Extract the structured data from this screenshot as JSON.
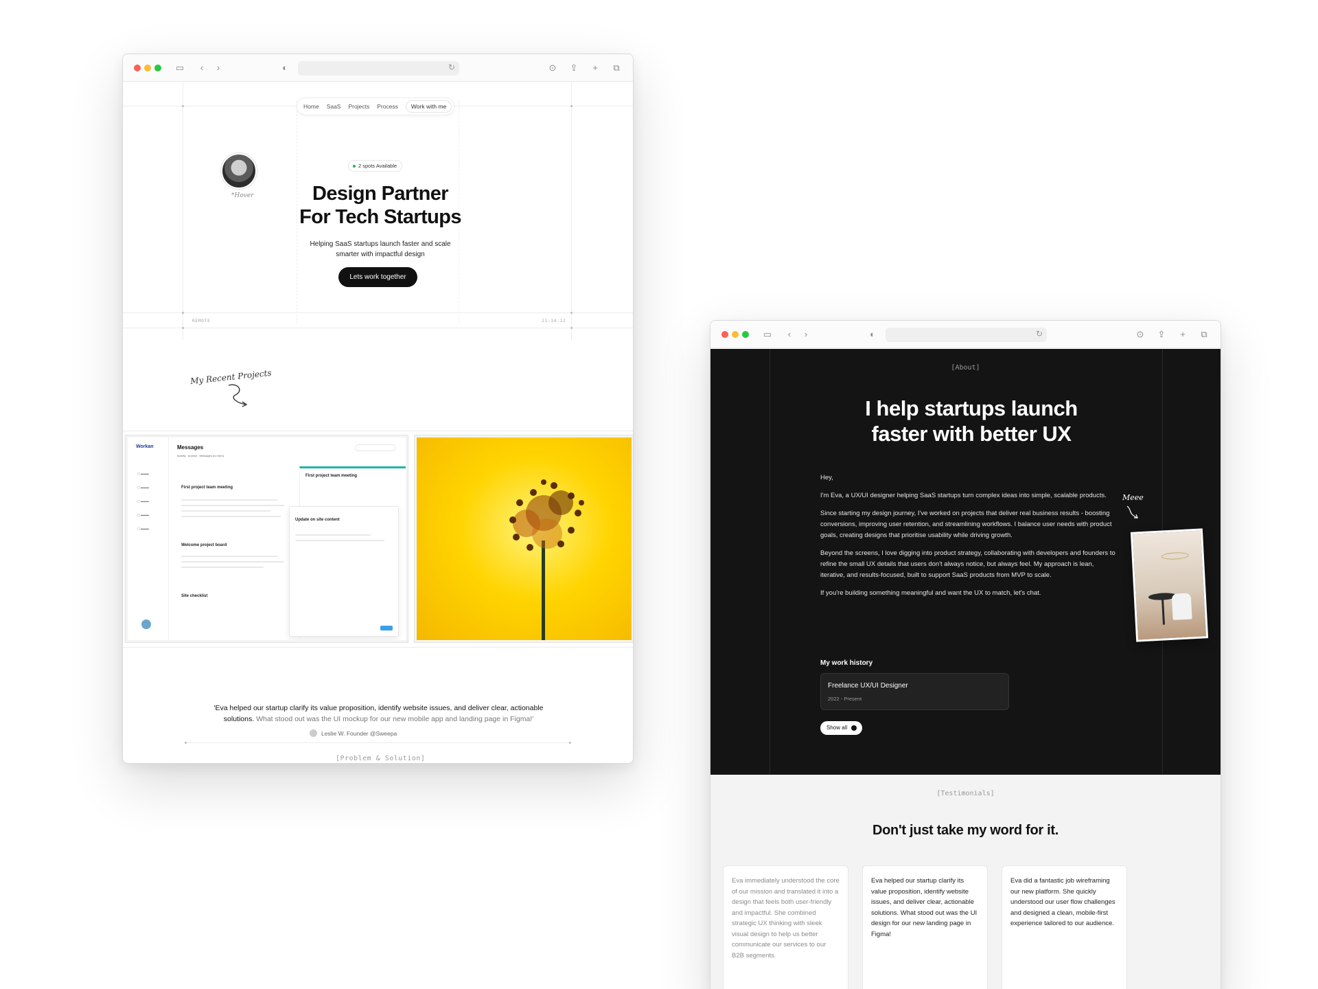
{
  "window1": {
    "nav": {
      "items": [
        "Home",
        "SaaS",
        "Projects",
        "Process"
      ],
      "cta": "Work with me"
    },
    "hover_note": "*Hover",
    "badge": "2 spots Available",
    "hero": {
      "title_line1": "Design Partner",
      "title_line2": "For Tech Startups",
      "subtitle": "Helping SaaS startups launch faster and scale smarter with impactful design",
      "cta": "Lets work together"
    },
    "footer_left": "REMOTE",
    "footer_right": "21:14:12",
    "recent_projects": "My Recent Projects",
    "project1": {
      "brand": "Workan",
      "title": "Messages",
      "tabs": [
        "Activity",
        "Archive",
        "Messages (no form)"
      ],
      "card_title": "First project team meeting",
      "popup_title": "Update on site content",
      "list_items": [
        "First project team meeting",
        "Welcome project board",
        "Site checklist"
      ]
    },
    "quote": {
      "main": "'Eva helped our startup clarify its value proposition, identify website issues, and deliver clear, actionable solutions.",
      "muted": "What stood out was the UI mockup for our new mobile app and landing page in Figma!'",
      "author": "Leslie W. Founder @Sweepa"
    },
    "section_tag": "[Problem & Solution]"
  },
  "window2": {
    "about_tag": "[About]",
    "title_line1": "I help startups launch",
    "title_line2": "faster with better UX",
    "paragraphs": [
      "Hey,",
      "I'm Eva, a UX/UI designer helping SaaS startups turn complex ideas into simple, scalable products.",
      "Since starting my design journey, I've worked on projects that deliver real business results - boosting conversions, improving user retention, and streamlining workflows. I balance user needs with product goals, creating designs that prioritise usability while driving growth.",
      "Beyond the screens, I love digging into product strategy, collaborating with developers and founders to refine the small UX details that users don't always notice, but always feel. My approach is lean, iterative, and results-focused, built to support SaaS products from MVP to scale.",
      "If you're building something meaningful and want the UX to match, let's chat."
    ],
    "meet": "Meee",
    "work_history": {
      "heading": "My work history",
      "role": "Freelance UX/UI Designer",
      "dates": "2022 - Present",
      "show_all": "Show all"
    },
    "testimonials_tag": "[Testimonials]",
    "testimonials_title": "Don't just take my word for it.",
    "testimonials": [
      "Eva immediately understood the core of our mission and translated it into a design that feels both user-friendly and impactful. She combined strategic UX thinking with sleek visual design to help us better communicate our services to our B2B segments.",
      "Eva helped our startup clarify its value proposition, identify website issues, and deliver clear, actionable solutions. What stood out was the UI design for our new landing page in Figma!",
      "Eva did a fantastic job wireframing our new platform. She quickly understood our user flow challenges and designed a clean, mobile-first experience tailored to our audience."
    ]
  }
}
